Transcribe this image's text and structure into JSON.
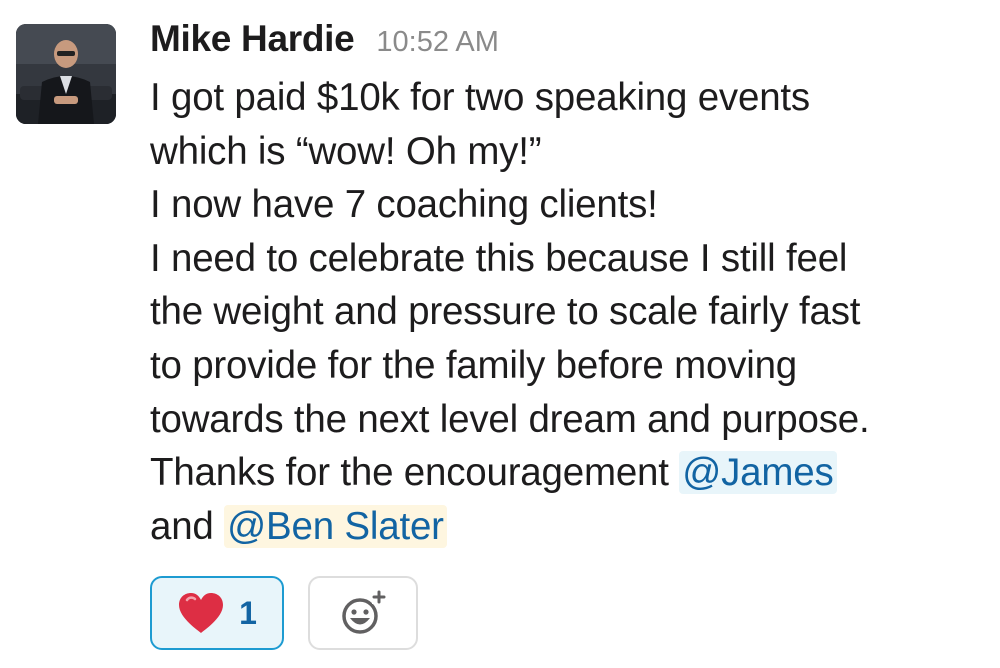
{
  "message": {
    "author": "Mike Hardie",
    "timestamp": "10:52 AM",
    "avatar_icon": "user-avatar-photo",
    "lines": [
      "I got paid $10k for two speaking events",
      "which is “wow! Oh my!”",
      "I now have 7 coaching clients!",
      "I need to celebrate this because I still feel",
      "the weight and pressure to scale fairly fast",
      "to provide for the family before moving",
      "towards the next level dream and purpose."
    ],
    "thanks_prefix": "Thanks for the encouragement ",
    "mention_james": "@James",
    "and_text": "and ",
    "mention_ben": "@Ben Slater"
  },
  "reactions": [
    {
      "emoji_icon": "red-heart-icon",
      "count": "1"
    }
  ],
  "add_reaction_icon": "add-reaction-icon",
  "colors": {
    "mention_text": "#1264a3",
    "mention_bg": "#e8f5fa",
    "mention_highlight_bg": "#fef6e0",
    "reaction_border": "#1d9bd1",
    "reaction_bg": "#e8f5fa",
    "timestamp": "#8a8a8a"
  }
}
